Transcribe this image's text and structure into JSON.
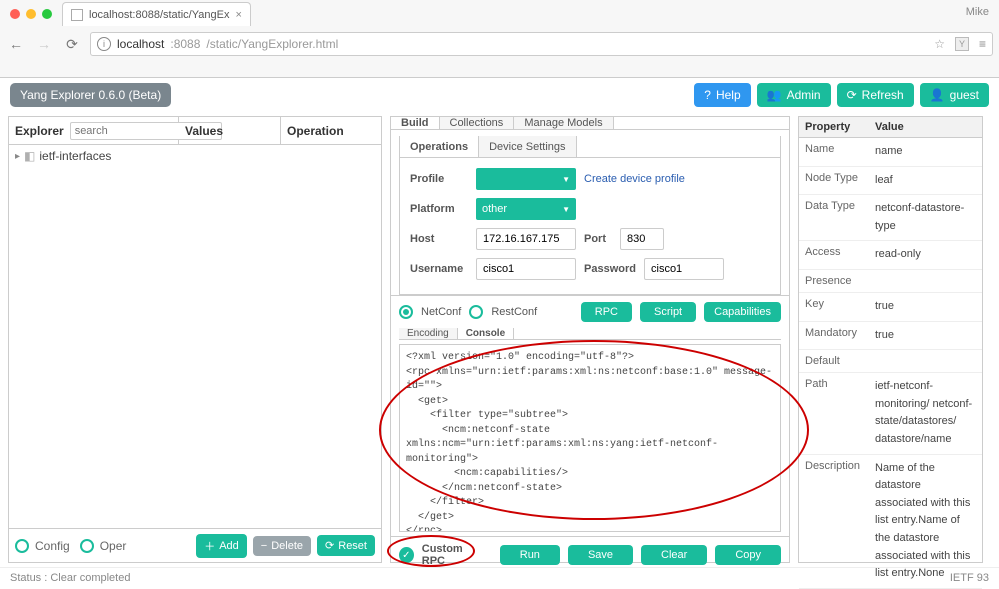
{
  "browser": {
    "tab_title": "localhost:8088/static/YangEx",
    "url_host": "localhost",
    "url_port": ":8088",
    "url_path": "/static/YangExplorer.html",
    "user": "Mike",
    "y_box": "Y"
  },
  "app_bar": {
    "title": "Yang Explorer 0.6.0 (Beta)",
    "help": "Help",
    "admin": "Admin",
    "refresh": "Refresh",
    "guest": "guest"
  },
  "left": {
    "explorer": "Explorer",
    "search_ph": "search",
    "values": "Values",
    "operation": "Operation",
    "tree_item": "ietf-interfaces",
    "config": "Config",
    "oper": "Oper",
    "add": "Add",
    "delete": "Delete",
    "reset": "Reset"
  },
  "center": {
    "tabs": {
      "build": "Build",
      "collections": "Collections",
      "manage": "Manage Models"
    },
    "subtabs": {
      "operations": "Operations",
      "device": "Device Settings"
    },
    "profile_lbl": "Profile",
    "profile_val": "",
    "create_link": "Create device profile",
    "platform_lbl": "Platform",
    "platform_val": "other",
    "host_lbl": "Host",
    "host_val": "172.16.167.175",
    "port_lbl": "Port",
    "port_val": "830",
    "user_lbl": "Username",
    "user_val": "cisco1",
    "pass_lbl": "Password",
    "pass_val": "cisco1",
    "netconf": "NetConf",
    "restconf": "RestConf",
    "rpc": "RPC",
    "script": "Script",
    "caps": "Capabilities",
    "ctabs": {
      "encoding": "Encoding",
      "console": "Console"
    },
    "xml": "<?xml version=\"1.0\" encoding=\"utf-8\"?>\n<rpc xmlns=\"urn:ietf:params:xml:ns:netconf:base:1.0\" message-id=\"\">\n  <get>\n    <filter type=\"subtree\">\n      <ncm:netconf-state xmlns:ncm=\"urn:ietf:params:xml:ns:yang:ietf-netconf-monitoring\">\n        <ncm:capabilities/>\n      </ncm:netconf-state>\n    </filter>\n  </get>\n</rpc>",
    "custom": "Custom RPC",
    "run": "Run",
    "save": "Save",
    "clear": "Clear",
    "copy": "Copy"
  },
  "right": {
    "prop": "Property",
    "val": "Value",
    "rows": [
      {
        "k": "Name",
        "v": "name"
      },
      {
        "k": "Node Type",
        "v": "leaf"
      },
      {
        "k": "Data Type",
        "v": "netconf-datastore-type"
      },
      {
        "k": "Access",
        "v": "read-only"
      },
      {
        "k": "Presence",
        "v": ""
      },
      {
        "k": "Key",
        "v": "true"
      },
      {
        "k": "Mandatory",
        "v": "true"
      },
      {
        "k": "Default",
        "v": ""
      },
      {
        "k": "Path",
        "v": "ietf-netconf-monitoring/ netconf-state/datastores/ datastore/name"
      },
      {
        "k": "Description",
        "v": "Name of the datastore associated with this list entry.Name of the datastore associated with this list entry.None"
      }
    ]
  },
  "status": {
    "left": "Status : Clear completed",
    "right": "IETF 93"
  }
}
